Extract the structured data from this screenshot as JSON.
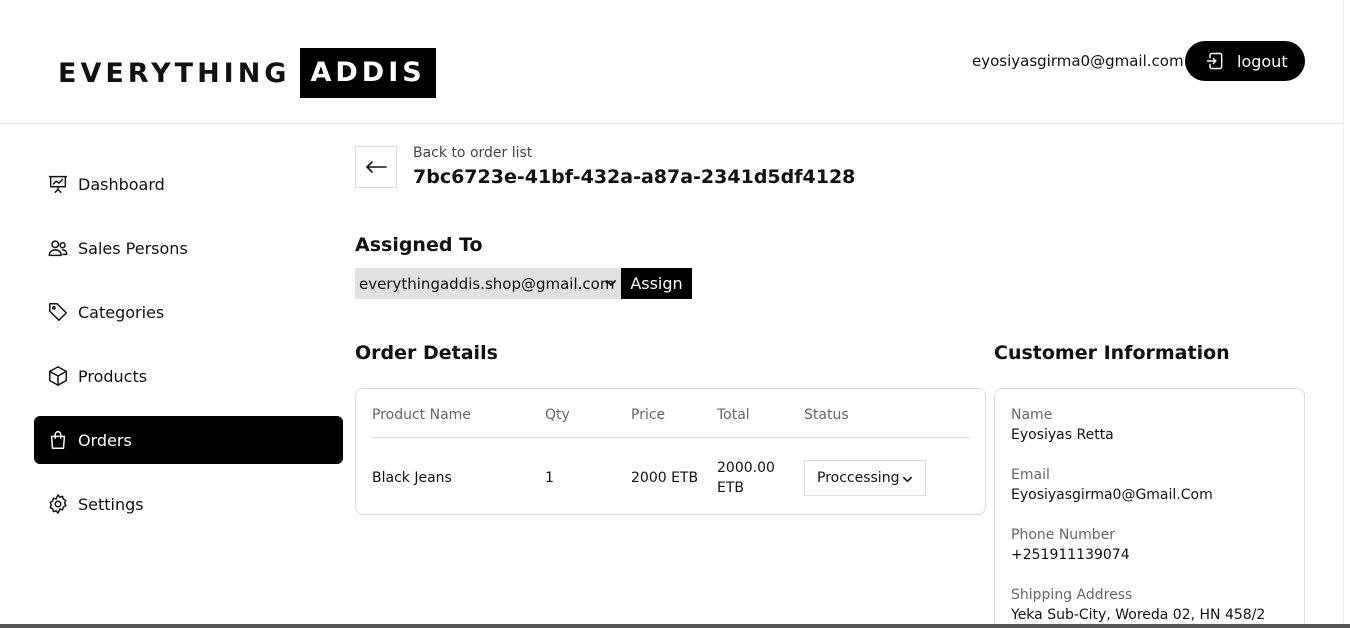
{
  "header": {
    "logo_part1": "EVERYTHING",
    "logo_part2": "ADDIS",
    "user_email": "eyosiyasgirma0@gmail.com",
    "logout_label": "logout"
  },
  "sidebar": {
    "items": [
      {
        "label": "Dashboard",
        "icon": "presentation-chart-icon"
      },
      {
        "label": "Sales Persons",
        "icon": "users-icon"
      },
      {
        "label": "Categories",
        "icon": "tag-icon"
      },
      {
        "label": "Products",
        "icon": "cube-icon"
      },
      {
        "label": "Orders",
        "icon": "shopping-bag-icon",
        "active": true
      },
      {
        "label": "Settings",
        "icon": "gear-icon"
      }
    ]
  },
  "order": {
    "back_label": "Back to order list",
    "id": "7bc6723e-41bf-432a-a87a-2341d5df4128"
  },
  "assignment": {
    "title": "Assigned To",
    "selected": "everythingaddis.shop@gmail.com",
    "button_label": "Assign"
  },
  "order_details": {
    "title": "Order Details",
    "columns": [
      "Product Name",
      "Qty",
      "Price",
      "Total",
      "Status"
    ],
    "rows": [
      {
        "product": "Black Jeans",
        "qty": "1",
        "price": "2000 ETB",
        "total_line1": "2000.00",
        "total_line2": "ETB",
        "status": "Proccessing"
      }
    ]
  },
  "customer": {
    "title": "Customer Information",
    "name_label": "Name",
    "name": "Eyosiyas Retta",
    "email_label": "Email",
    "email": "Eyosiyasgirma0@Gmail.Com",
    "phone_label": "Phone Number",
    "phone": "+251911139074",
    "address_label": "Shipping Address",
    "address": "Yeka Sub-City, Woreda 02, HN 458/2"
  },
  "colors": {
    "accent": "#000000",
    "border": "#dcdcdc",
    "muted_text": "#666666",
    "select_bg": "#e1e1e1"
  }
}
